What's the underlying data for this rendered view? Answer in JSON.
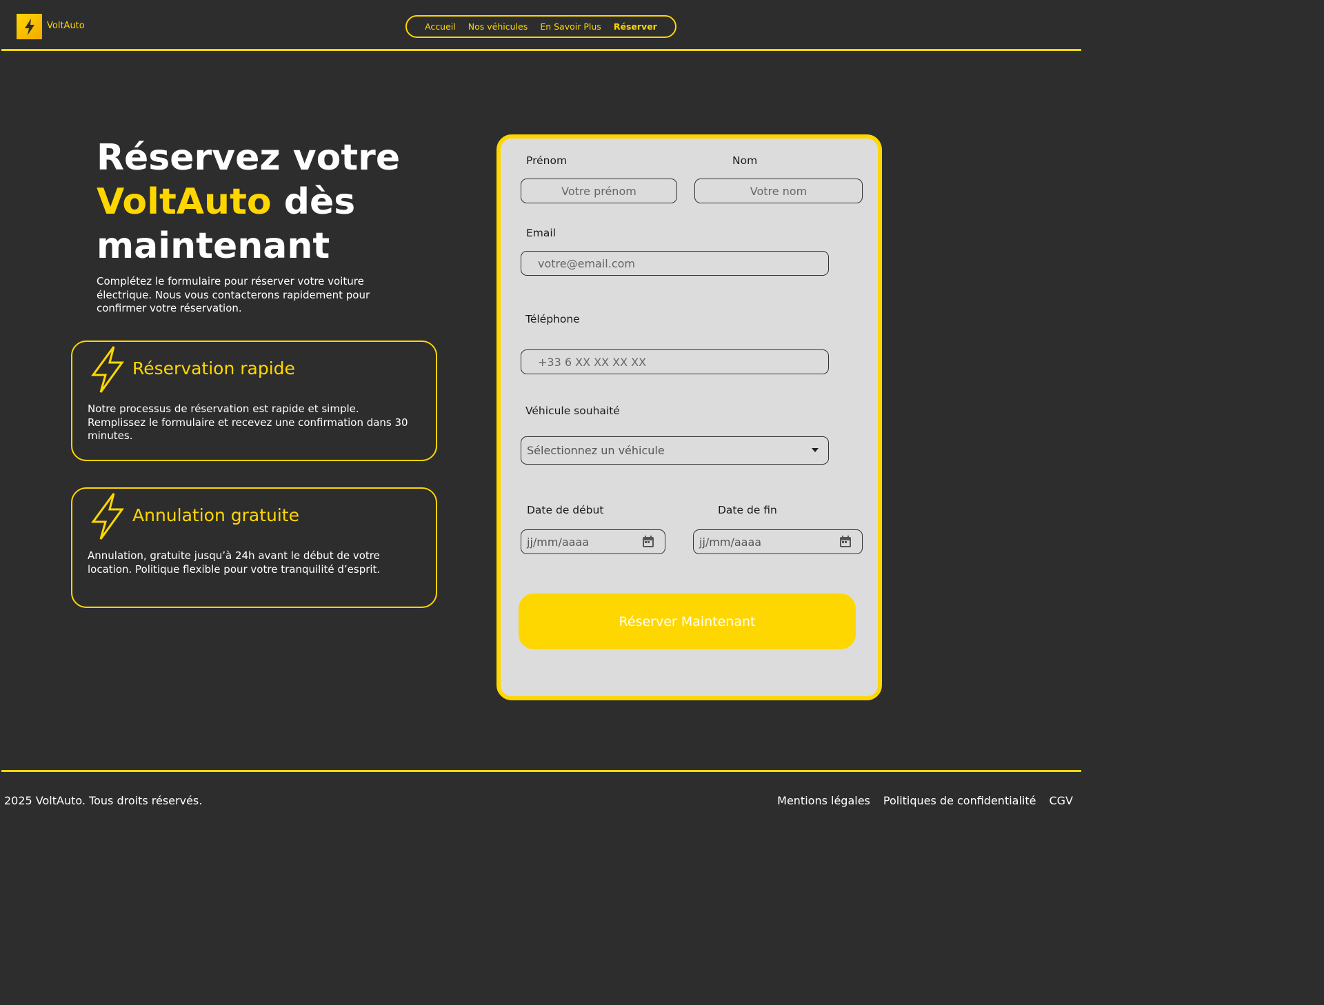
{
  "header": {
    "brand": "VoltAuto",
    "logo_icon": "lightning-bolt-icon",
    "nav": {
      "home": "Accueil",
      "vehicles": "Nos véhicules",
      "learn_more": "En Savoir Plus",
      "book": "Réserver"
    }
  },
  "hero": {
    "title_part1": "Réservez votre",
    "title_accent": "VoltAuto",
    "title_part2": " dès",
    "title_part3": "maintenant",
    "description": "Complétez le formulaire pour réserver votre voiture électrique. Nous vous contacterons rapidement pour confirmer votre réservation."
  },
  "features": [
    {
      "icon": "lightning-bolt-icon",
      "title": "Réservation rapide",
      "text": "Notre processus de réservation est rapide et simple. Remplissez le formulaire et recevez une confirmation dans 30 minutes."
    },
    {
      "icon": "lightning-bolt-icon",
      "title": "Annulation gratuite",
      "text": "Annulation, gratuite jusqu’à 24h avant le début de votre location. Politique flexible pour votre tranquilité d’esprit."
    }
  ],
  "form": {
    "first_name_label": "Prénom",
    "first_name_placeholder": "Votre prénom",
    "last_name_label": "Nom",
    "last_name_placeholder": "Votre nom",
    "email_label": "Email",
    "email_placeholder": "votre@email.com",
    "phone_label": "Téléphone",
    "phone_placeholder": "+33 6 XX XX XX XX",
    "vehicle_label": "Véhicule souhaité",
    "vehicle_selected": "Sélectionnez un véhicule",
    "start_date_label": "Date de début",
    "start_date_placeholder": "jj/mm/aaaa",
    "end_date_label": "Date de fin",
    "end_date_placeholder": "jj/mm/aaaa",
    "submit_label": "Réserver Maintenant"
  },
  "footer": {
    "copyright": "2025 VoltAuto. Tous droits réservés.",
    "links": {
      "legal": "Mentions légales",
      "privacy": "Politiques de confidentialité",
      "terms": "CGV"
    }
  },
  "colors": {
    "accent": "#ffd700",
    "background": "#2d2d2d",
    "form_background": "#dcdcdc"
  }
}
